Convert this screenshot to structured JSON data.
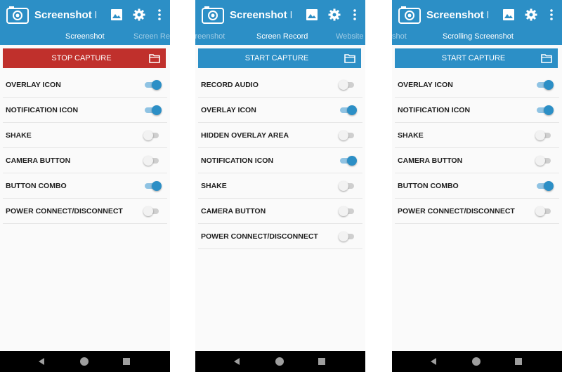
{
  "colors": {
    "primary": "#2c8fc6",
    "stop": "#c0302c",
    "toggle_on": "#2c8fc6",
    "toggle_off": "#cfcfcf"
  },
  "panels": [
    {
      "app_title": "Screenshot Ea...",
      "tabs": [
        "Screenshot",
        "Screen Reco"
      ],
      "capture_button": {
        "label": "STOP CAPTURE",
        "state": "stop"
      },
      "settings": [
        {
          "label": "OVERLAY ICON",
          "on": true
        },
        {
          "label": "NOTIFICATION ICON",
          "on": true
        },
        {
          "label": "SHAKE",
          "on": false
        },
        {
          "label": "CAMERA BUTTON",
          "on": false
        },
        {
          "label": "BUTTON COMBO",
          "on": true
        },
        {
          "label": "POWER CONNECT/DISCONNECT",
          "on": false
        }
      ]
    },
    {
      "app_title": "Screenshot Ea...",
      "tabs": [
        "creenshot",
        "Screen Record",
        "Website S"
      ],
      "capture_button": {
        "label": "START CAPTURE",
        "state": "start"
      },
      "settings": [
        {
          "label": "RECORD AUDIO",
          "on": false
        },
        {
          "label": "OVERLAY ICON",
          "on": true
        },
        {
          "label": "HIDDEN OVERLAY AREA",
          "on": false
        },
        {
          "label": "NOTIFICATION ICON",
          "on": true
        },
        {
          "label": "SHAKE",
          "on": false
        },
        {
          "label": "CAMERA BUTTON",
          "on": false
        },
        {
          "label": "POWER CONNECT/DISCONNECT",
          "on": false
        }
      ]
    },
    {
      "app_title": "Screenshot Ea...",
      "tabs": [
        "shot",
        "Scrolling Screenshot"
      ],
      "capture_button": {
        "label": "START CAPTURE",
        "state": "start"
      },
      "settings": [
        {
          "label": "OVERLAY ICON",
          "on": true
        },
        {
          "label": "NOTIFICATION ICON",
          "on": true
        },
        {
          "label": "SHAKE",
          "on": false
        },
        {
          "label": "CAMERA BUTTON",
          "on": false
        },
        {
          "label": "BUTTON COMBO",
          "on": true
        },
        {
          "label": "POWER CONNECT/DISCONNECT",
          "on": false
        }
      ]
    }
  ],
  "icons": {
    "app": "camera-icon",
    "gallery": "gallery-icon",
    "settings": "gear-icon",
    "menu": "kebab-menu-icon",
    "folder": "folder-icon",
    "nav_back": "back-icon",
    "nav_home": "home-icon",
    "nav_recent": "recents-icon"
  }
}
